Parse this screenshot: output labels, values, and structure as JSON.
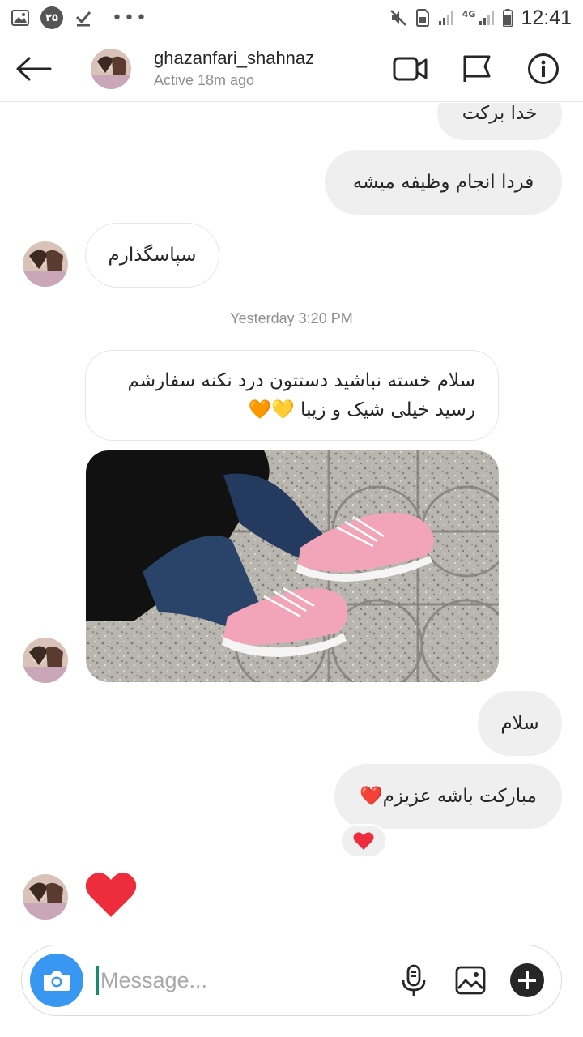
{
  "status_bar": {
    "time": "12:41",
    "notification_count": "۲۵",
    "network": "4G",
    "dots": "•••"
  },
  "header": {
    "username": "ghazanfari_shahnaz",
    "active_status": "Active 18m ago"
  },
  "messages": {
    "m1": "خدا برکت",
    "m2": "فردا انجام وظیفه میشه",
    "m3": "سپاسگذارم",
    "timestamp": "Yesterday 3:20 PM",
    "m4_line1": "سلام خسته نباشید دستتون درد نکنه سفارشم",
    "m4_line2": "رسید خیلی شیک و زیبا 💛🧡",
    "m5": "سلام",
    "m6": "مبارکت باشه عزیزم❤️"
  },
  "composer": {
    "placeholder": "Message..."
  },
  "colors": {
    "accent_blue": "#3897f0",
    "bubble_gray": "#efefef",
    "heart_red": "#ed4956"
  }
}
